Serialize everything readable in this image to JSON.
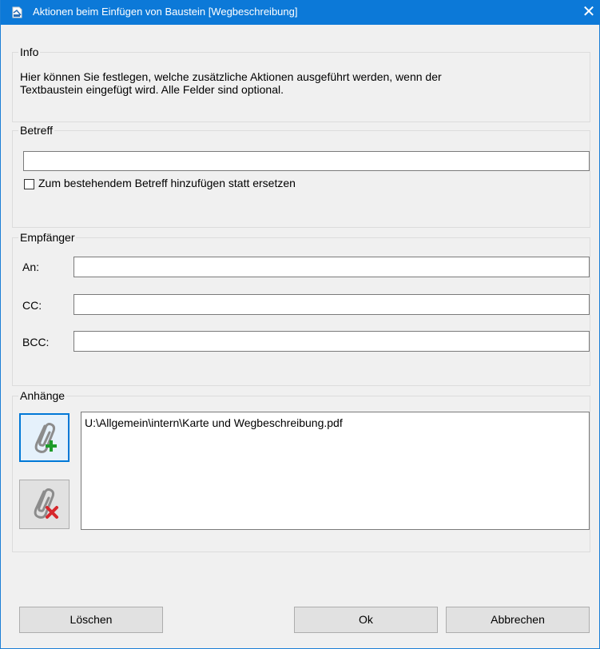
{
  "window": {
    "title": "Aktionen beim Einfügen von Baustein [Wegbeschreibung]",
    "close_glyph": "✕",
    "accent_color": "#0c79d8"
  },
  "info": {
    "legend": "Info",
    "text_line1": "Hier können Sie festlegen, welche zusätzliche Aktionen ausgeführt werden, wenn der",
    "text_line2": "Textbaustein eingefügt wird. Alle Felder sind optional."
  },
  "betreff": {
    "legend": "Betreff",
    "value": "",
    "checkbox_label": "Zum bestehendem Betreff hinzufügen statt ersetzen",
    "checkbox_checked": false
  },
  "empfaenger": {
    "legend": "Empfänger",
    "fields": [
      {
        "label": "An:",
        "value": ""
      },
      {
        "label": "CC:",
        "value": ""
      },
      {
        "label": "BCC:",
        "value": ""
      }
    ]
  },
  "anhaenge": {
    "legend": "Anhänge",
    "items": [
      "U:\\Allgemein\\intern\\Karte und Wegbeschreibung.pdf"
    ],
    "add_icon": "paperclip-add-icon",
    "remove_icon": "paperclip-remove-icon"
  },
  "buttons": {
    "delete": "Löschen",
    "ok": "Ok",
    "cancel": "Abbrechen"
  }
}
